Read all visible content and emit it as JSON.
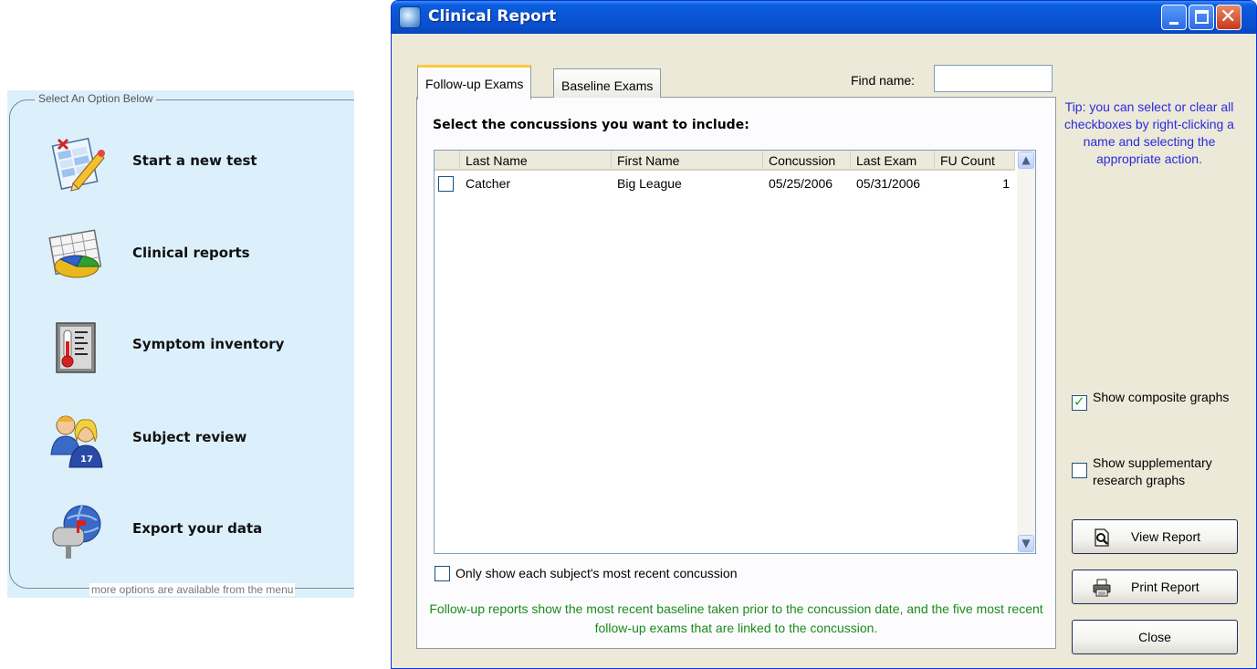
{
  "menu": {
    "legend": "Select An Option Below",
    "footer": "more options are available from the menu",
    "items": [
      {
        "label": "Start a new test",
        "icon": "new-test-icon"
      },
      {
        "label": "Clinical reports",
        "icon": "reports-chart-icon"
      },
      {
        "label": "Symptom inventory",
        "icon": "thermometer-icon"
      },
      {
        "label": "Subject review",
        "icon": "subjects-icon"
      },
      {
        "label": "Export your data",
        "icon": "export-mailbox-icon"
      }
    ]
  },
  "window": {
    "title": "Clinical Report",
    "tabs": [
      "Follow-up Exams",
      "Baseline Exams"
    ],
    "find_label": "Find name:",
    "find_value": "",
    "heading": "Select the concussions you want to include:",
    "columns": [
      "Last Name",
      "First Name",
      "Concussion",
      "Last Exam",
      "FU Count"
    ],
    "rows": [
      {
        "checked": false,
        "last_name": "Catcher",
        "first_name": "Big League",
        "concussion": "05/25/2006",
        "last_exam": "05/31/2006",
        "fu_count": "1"
      }
    ],
    "only_recent_label": "Only show each subject's most recent concussion",
    "only_recent_checked": false,
    "note": "Follow-up reports show the most recent baseline taken prior to the concussion date, and the five most recent follow-up exams that are linked to the concussion.",
    "tip": "Tip: you can select or clear all checkboxes by right-clicking a name and selecting the appropriate action.",
    "composite_label": "Show composite graphs",
    "composite_checked": true,
    "supplementary_label": "Show supplementary research graphs",
    "supplementary_checked": false,
    "buttons": {
      "view_report": "View Report",
      "print_report": "Print Report",
      "close": "Close"
    },
    "colors": {
      "titlebar": "#0a53d4",
      "tip_text": "#2a2adf",
      "note_text": "#1b8a1b",
      "menu_background": "#dcf0fc"
    }
  }
}
